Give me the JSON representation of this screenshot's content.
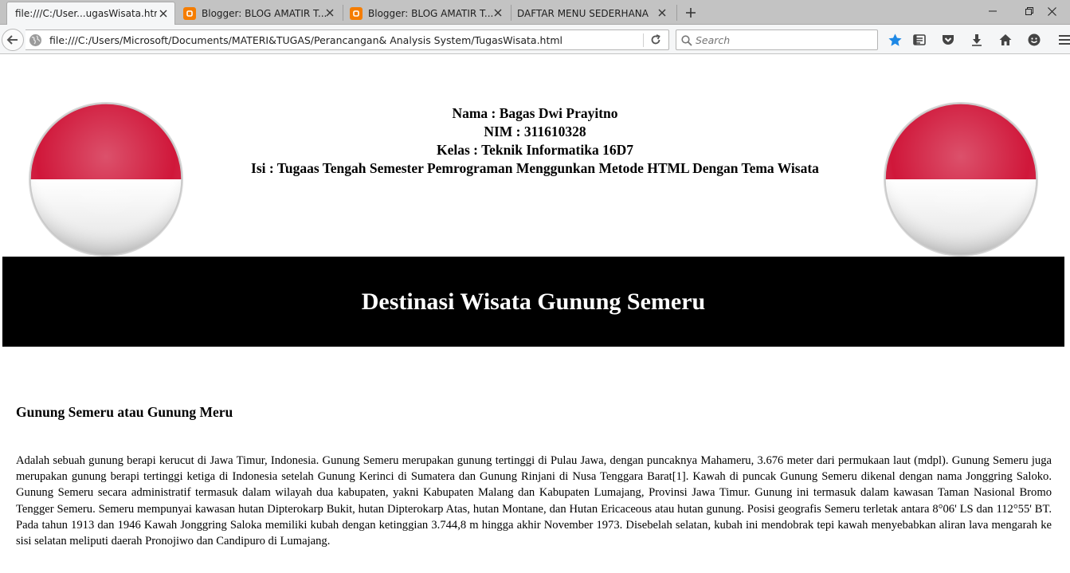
{
  "browser": {
    "tabs": [
      {
        "label": "file:///C:/User...ugasWisata.html",
        "active": true
      },
      {
        "label": "Blogger: BLOG AMATIR T...",
        "active": false
      },
      {
        "label": "Blogger: BLOG AMATIR T...",
        "active": false
      },
      {
        "label": "DAFTAR MENU SEDERHANA",
        "active": false
      }
    ],
    "url": "file:///C:/Users/Microsoft/Documents/MATERI&TUGAS/Perancangan& Analysis System/TugasWisata.html",
    "search_placeholder": "Search",
    "colors": {
      "accent_star": "#1e88e5",
      "favicon_blogger": "#f57d00"
    }
  },
  "page": {
    "info": {
      "nama": "Nama : Bagas Dwi Prayitno",
      "nim": "NIM : 311610328",
      "kelas": "Kelas : Teknik Informatika 16D7",
      "isi": "Isi : Tugaas Tengah Semester Pemrograman Menggunkan Metode HTML Dengan Tema Wisata"
    },
    "flag_colors": {
      "red": "#d0173a",
      "white": "#ffffff"
    },
    "banner_title": "Destinasi Wisata Gunung Semeru",
    "subheading": "Gunung Semeru atau Gunung Meru",
    "paragraph": "Adalah sebuah gunung berapi kerucut di Jawa Timur, Indonesia. Gunung Semeru merupakan gunung tertinggi di Pulau Jawa, dengan puncaknya Mahameru, 3.676 meter dari permukaan laut (mdpl). Gunung Semeru juga merupakan gunung berapi tertinggi ketiga di Indonesia setelah Gunung Kerinci di Sumatera dan Gunung Rinjani di Nusa Tenggara Barat[1]. Kawah di puncak Gunung Semeru dikenal dengan nama Jonggring Saloko. Gunung Semeru secara administratif termasuk dalam wilayah dua kabupaten, yakni Kabupaten Malang dan Kabupaten Lumajang, Provinsi Jawa Timur. Gunung ini termasuk dalam kawasan Taman Nasional Bromo Tengger Semeru. Semeru mempunyai kawasan hutan Dipterokarp Bukit, hutan Dipterokarp Atas, hutan Montane, dan Hutan Ericaceous atau hutan gunung. Posisi geografis Semeru terletak antara 8°06' LS dan 112°55' BT. Pada tahun 1913 dan 1946 Kawah Jonggring Saloka memiliki kubah dengan ketinggian 3.744,8 m hingga akhir November 1973. Disebelah selatan, kubah ini mendobrak tepi kawah menyebabkan aliran lava mengarah ke sisi selatan meliputi daerah Pronojiwo dan Candipuro di Lumajang."
  }
}
